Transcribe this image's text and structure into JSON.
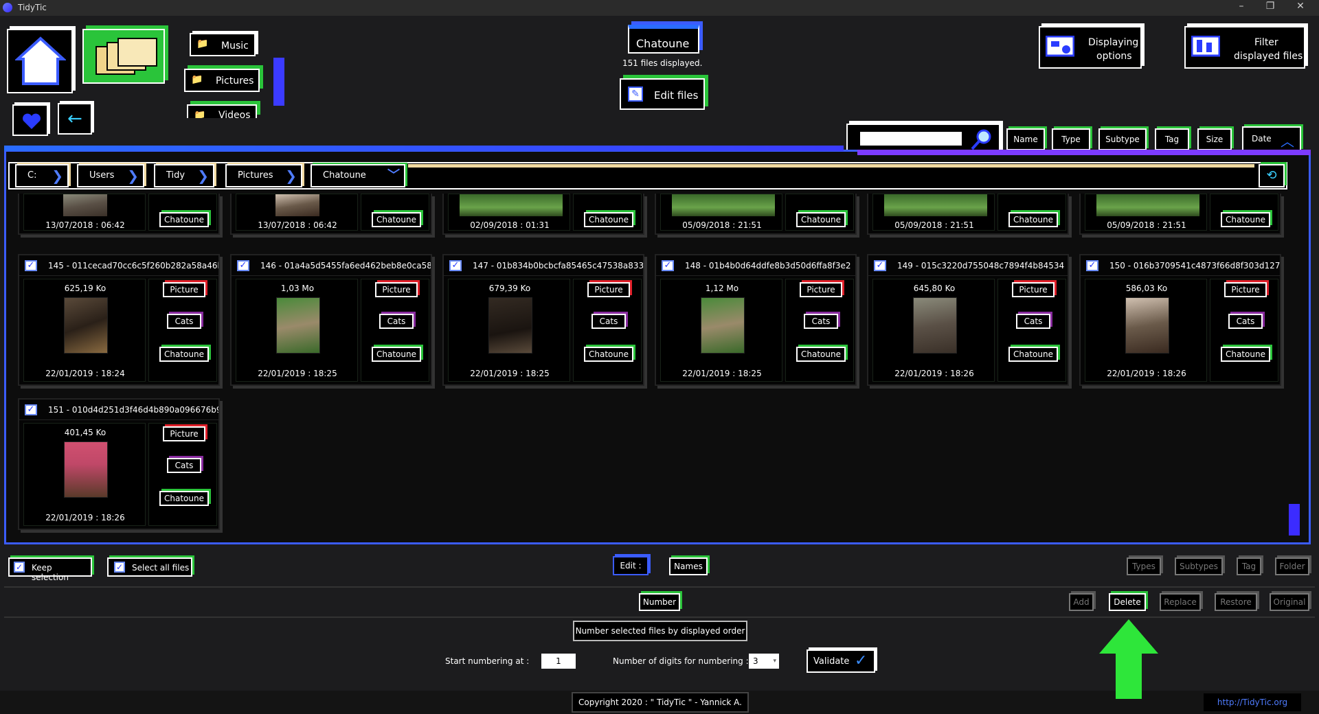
{
  "titlebar": {
    "title": "TidyTic",
    "minimize": "–",
    "restore": "❐",
    "close": "✕"
  },
  "nav": {
    "music": "Music",
    "pictures": "Pictures",
    "videos": "Videos"
  },
  "header": {
    "folder_name": "Chatoune",
    "files_displayed": "151 files displayed.",
    "edit_files": "Edit files",
    "displaying_options_line1": "Displaying",
    "displaying_options_line2": "options",
    "filter_line1": "Filter",
    "filter_line2": "displayed files"
  },
  "sort": {
    "name": "Name",
    "type": "Type",
    "subtype": "Subtype",
    "tag": "Tag",
    "size": "Size",
    "date": "Date"
  },
  "breadcrumb": [
    "C:",
    "Users",
    "Tidy",
    "Pictures",
    "Chatoune"
  ],
  "top_row": [
    {
      "date": "13/07/2018 : 06:42",
      "folder": "Chatoune"
    },
    {
      "date": "13/07/2018 : 06:42",
      "folder": "Chatoune"
    },
    {
      "date": "02/09/2018 : 01:31",
      "folder": "Chatoune"
    },
    {
      "date": "05/09/2018 : 21:51",
      "folder": "Chatoune"
    },
    {
      "date": "05/09/2018 : 21:51",
      "folder": "Chatoune"
    },
    {
      "date": "05/09/2018 : 21:51",
      "folder": "Chatoune"
    }
  ],
  "files": [
    {
      "title": "145 - 011cecad70cc6c5f260b282a58a46b",
      "size": "625,19 Ko",
      "type": "Picture",
      "subtype": "Cats",
      "folder": "Chatoune",
      "date": "22/01/2019 : 18:24"
    },
    {
      "title": "146 - 01a4a5d5455fa6ed462beb8e0ca58",
      "size": "1,03 Mo",
      "type": "Picture",
      "subtype": "Cats",
      "folder": "Chatoune",
      "date": "22/01/2019 : 18:25"
    },
    {
      "title": "147 - 01b834b0bcbcfa85465c47538a833",
      "size": "679,39 Ko",
      "type": "Picture",
      "subtype": "Cats",
      "folder": "Chatoune",
      "date": "22/01/2019 : 18:25"
    },
    {
      "title": "148 - 01b4b0d64ddfe8b3d50d6ffa8f3e2",
      "size": "1,12 Mo",
      "type": "Picture",
      "subtype": "Cats",
      "folder": "Chatoune",
      "date": "22/01/2019 : 18:25"
    },
    {
      "title": "149 - 015c3220d755048c7894f4b84534",
      "size": "645,80 Ko",
      "type": "Picture",
      "subtype": "Cats",
      "folder": "Chatoune",
      "date": "22/01/2019 : 18:26"
    },
    {
      "title": "150 - 016b3709541c4873f66d8f303d127",
      "size": "586,03 Ko",
      "type": "Picture",
      "subtype": "Cats",
      "folder": "Chatoune",
      "date": "22/01/2019 : 18:26"
    },
    {
      "title": "151 - 010d4d251d3f46d4b890a096676b9",
      "size": "401,45 Ko",
      "type": "Picture",
      "subtype": "Cats",
      "folder": "Chatoune",
      "date": "22/01/2019 : 18:26"
    }
  ],
  "actions": {
    "keep_selection": "Keep selection",
    "select_all": "Select all files",
    "edit": "Edit :",
    "names": "Names",
    "types": "Types",
    "subtypes": "Subtypes",
    "tag": "Tag",
    "folder": "Folder",
    "number": "Number",
    "add": "Add",
    "delete": "Delete",
    "replace": "Replace",
    "restore": "Restore",
    "original": "Original"
  },
  "numbering": {
    "title": "Number selected files by displayed order",
    "start_label": "Start numbering at :",
    "start_value": "1",
    "digits_label": "Number of digits for numbering :",
    "digits_value": "3",
    "validate": "Validate"
  },
  "footer": {
    "copyright": "Copyright 2020 : \" TidyTic \" - Yannick A.",
    "url": "http://TidyTic.org"
  },
  "colors": {
    "accent_green": "#2ac43a",
    "accent_blue": "#3b5cff",
    "accent_purple": "#7c3bff",
    "type_red": "#e0202a",
    "subtype_purple": "#8a2ca0"
  }
}
